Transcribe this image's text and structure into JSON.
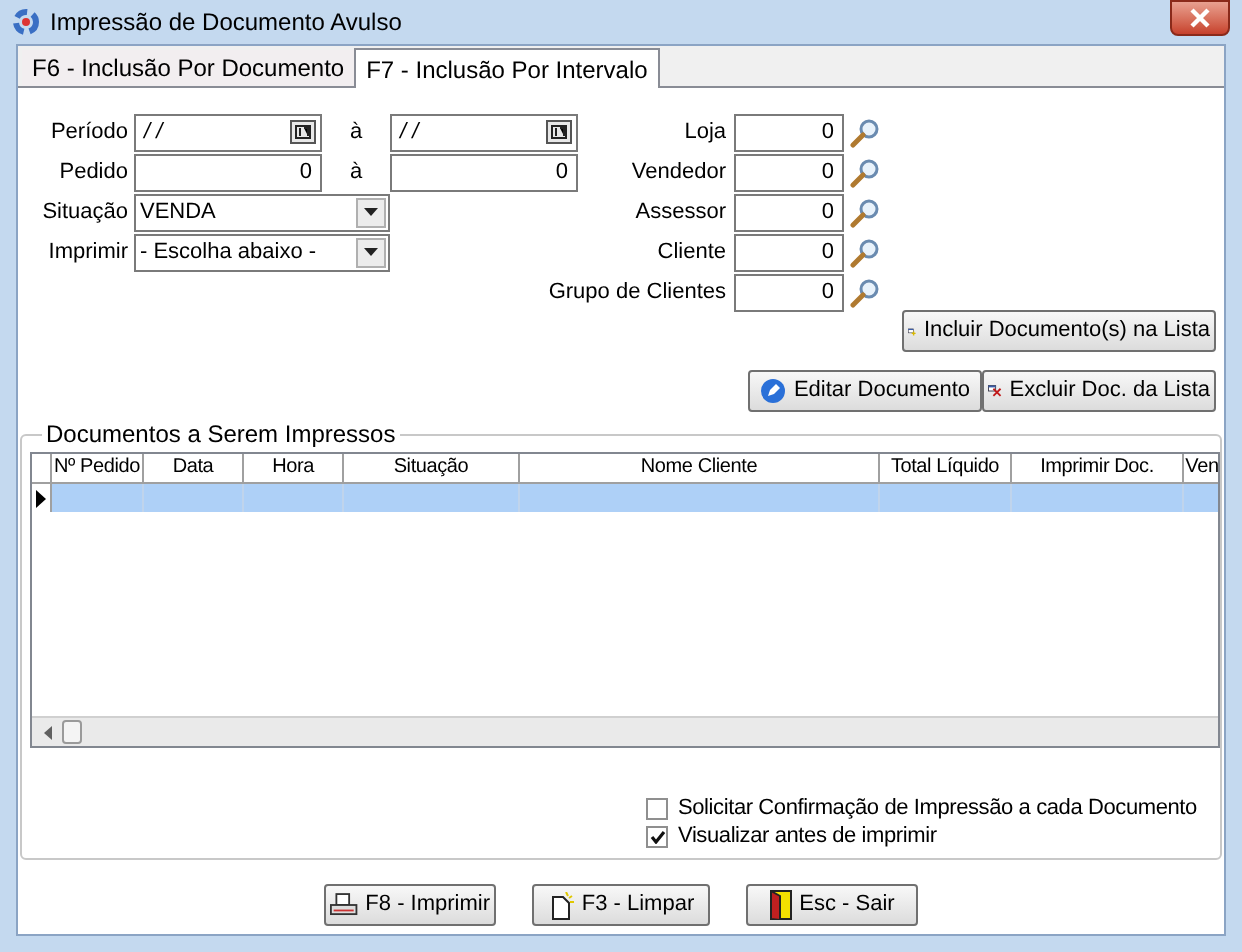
{
  "window": {
    "title": "Impressão de Documento Avulso"
  },
  "tabs": [
    {
      "label": "F6 - Inclusão Por Documento",
      "selected": false
    },
    {
      "label": "F7 - Inclusão Por Intervalo",
      "selected": true
    }
  ],
  "range_fields": [
    {
      "label": "Período",
      "kind": "date",
      "from": "/ /",
      "separator": "à",
      "to": "/ /"
    },
    {
      "label": "Pedido",
      "kind": "number",
      "from": "0",
      "separator": "à",
      "to": "0"
    }
  ],
  "dropdowns": [
    {
      "label": "Situação",
      "value": "VENDA"
    },
    {
      "label": "Imprimir",
      "value": "- Escolha abaixo -"
    }
  ],
  "lookups": [
    {
      "label": "Loja",
      "value": "0"
    },
    {
      "label": "Vendedor",
      "value": "0"
    },
    {
      "label": "Assessor",
      "value": "0"
    },
    {
      "label": "Cliente",
      "value": "0"
    },
    {
      "label": "Grupo de Clientes",
      "value": "0"
    }
  ],
  "include_button": {
    "label": "Incluir Documento(s) na Lista"
  },
  "list_buttons": [
    {
      "label": "Editar Documento",
      "kind": "edit"
    },
    {
      "label": "Excluir Doc. da Lista",
      "kind": "delete"
    }
  ],
  "documents": {
    "title": "Documentos a Serem Impressos",
    "columns": [
      "Nº Pedido",
      "Data",
      "Hora",
      "Situação",
      "Nome Cliente",
      "Total Líquido",
      "Imprimir Doc.",
      "Ven"
    ],
    "rows": [
      {
        "selected": true
      }
    ]
  },
  "options": [
    {
      "label": "Solicitar Confirmação de Impressão a cada Documento",
      "checked": false
    },
    {
      "label": "Visualizar antes de imprimir",
      "checked": true
    }
  ],
  "footer_buttons": [
    {
      "label": "F8 - Imprimir",
      "kind": "print"
    },
    {
      "label": "F3 - Limpar",
      "kind": "clear"
    },
    {
      "label": "Esc - Sair",
      "kind": "exit"
    }
  ]
}
